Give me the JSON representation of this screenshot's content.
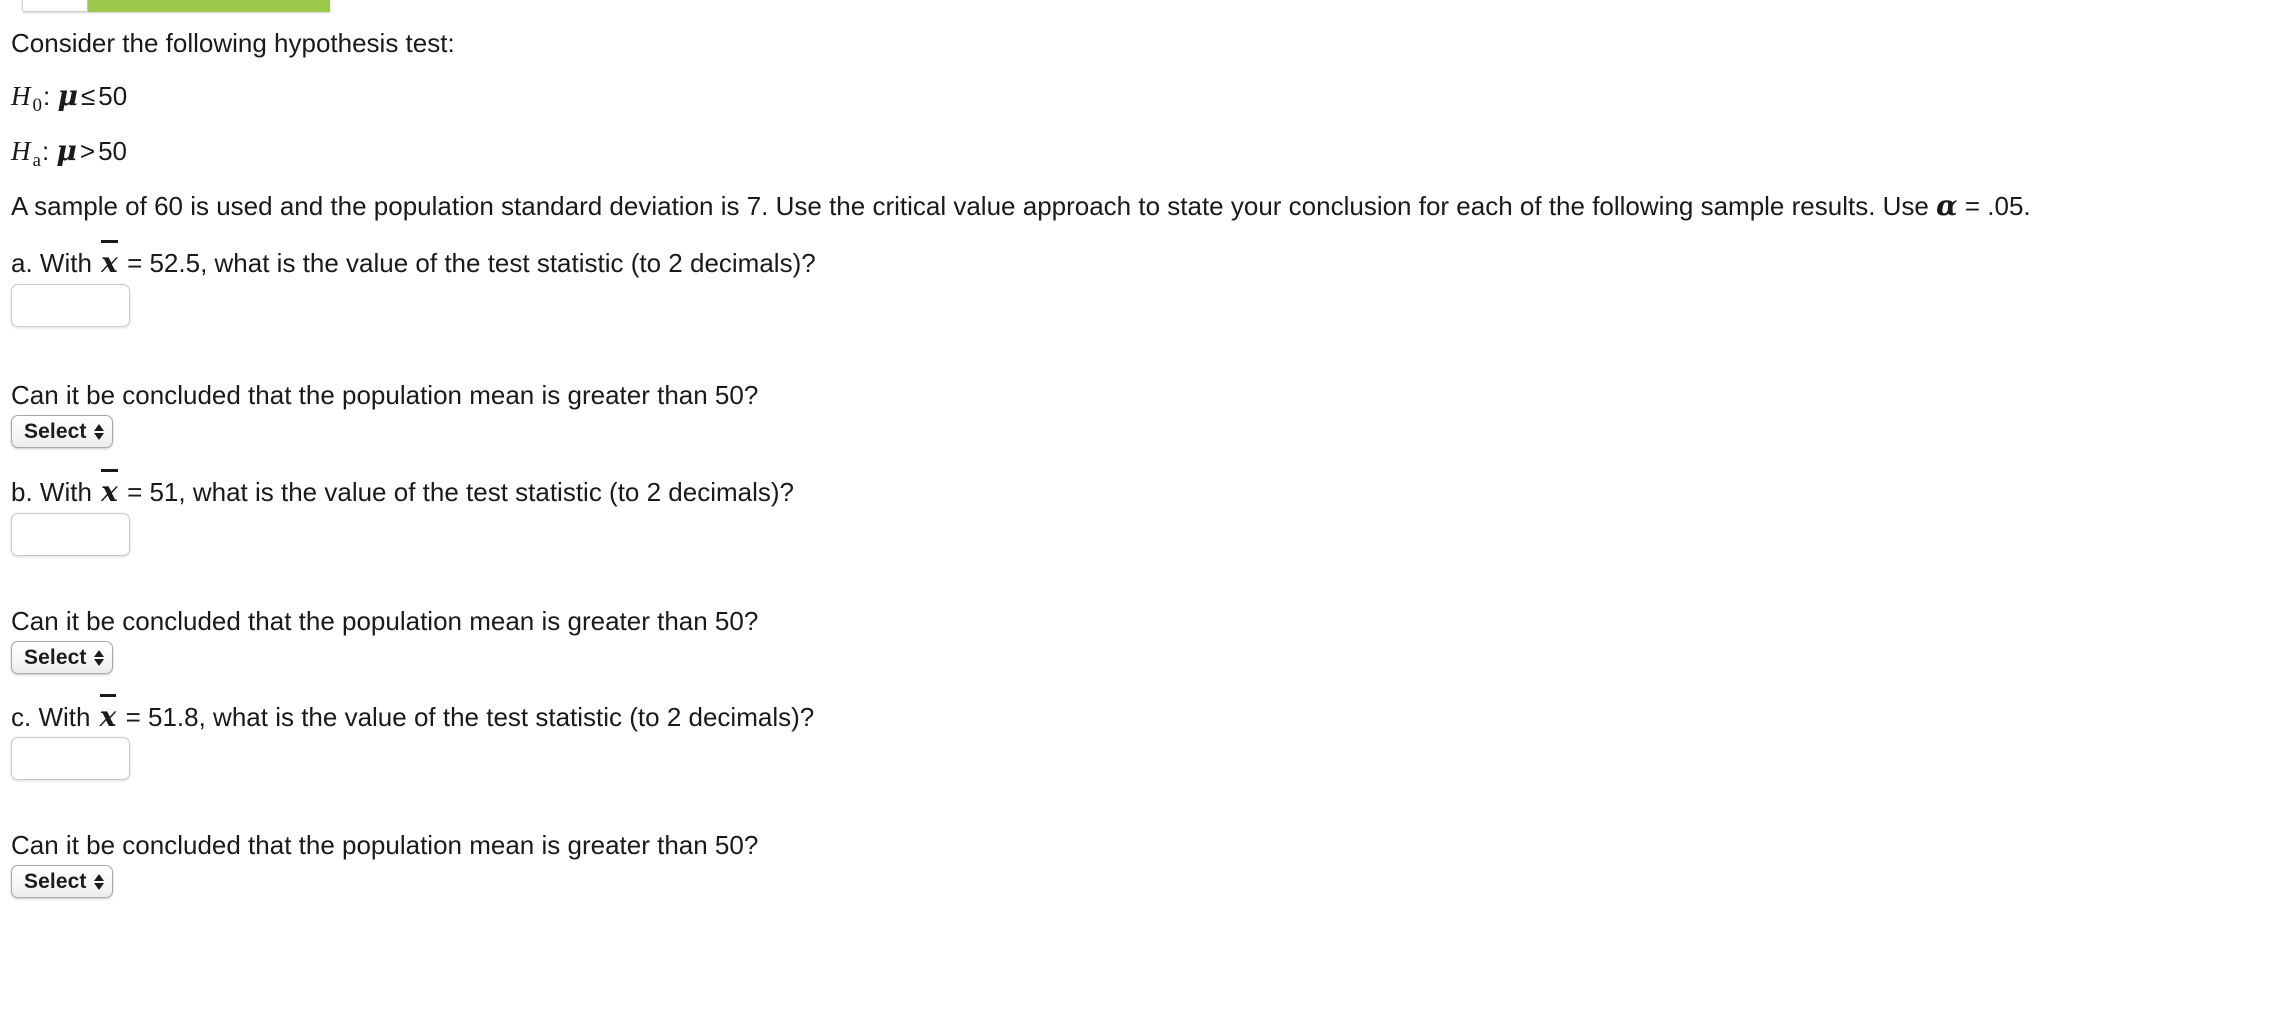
{
  "banner": {
    "green_color": "#9ac94a",
    "white_segment_name": "progress-segment-white",
    "green_segment_name": "progress-segment-green"
  },
  "question": {
    "intro": "Consider the following hypothesis test:",
    "hypotheses": {
      "null": {
        "symbol": "H",
        "subscript": "0",
        "colon": ":",
        "parameter": "μ",
        "relation": "≤",
        "value": "50"
      },
      "alternative": {
        "symbol": "H",
        "subscript": "a",
        "colon": ":",
        "parameter": "μ",
        "relation": ">",
        "value": "50"
      }
    },
    "setup_prefix": "A sample of 60 is used and the population standard deviation is 7. Use the critical value approach to state your conclusion for each of the following sample results. Use ",
    "setup_alpha": "α",
    "setup_suffix": " = .05.",
    "conclusion_prompt": "Can it be concluded that the population mean is greater than 50?"
  },
  "parts": [
    {
      "id": "a",
      "prefix": "a. With ",
      "xbar_glyph": "x",
      "middle": " = 52.5, what is the value of the test statistic (to 2 decimals)?",
      "answer_value": "",
      "answer_placeholder": "",
      "select_label": "Select"
    },
    {
      "id": "b",
      "prefix": "b. With ",
      "xbar_glyph": "x",
      "middle": " = 51, what is the value of the test statistic (to 2 decimals)?",
      "answer_value": "",
      "answer_placeholder": "",
      "select_label": "Select"
    },
    {
      "id": "c",
      "prefix": "c. With ",
      "xbar_glyph": "x",
      "middle": " = 51.8, what is the value of the test statistic (to 2 decimals)?",
      "answer_value": "",
      "answer_placeholder": "",
      "select_label": "Select"
    }
  ]
}
